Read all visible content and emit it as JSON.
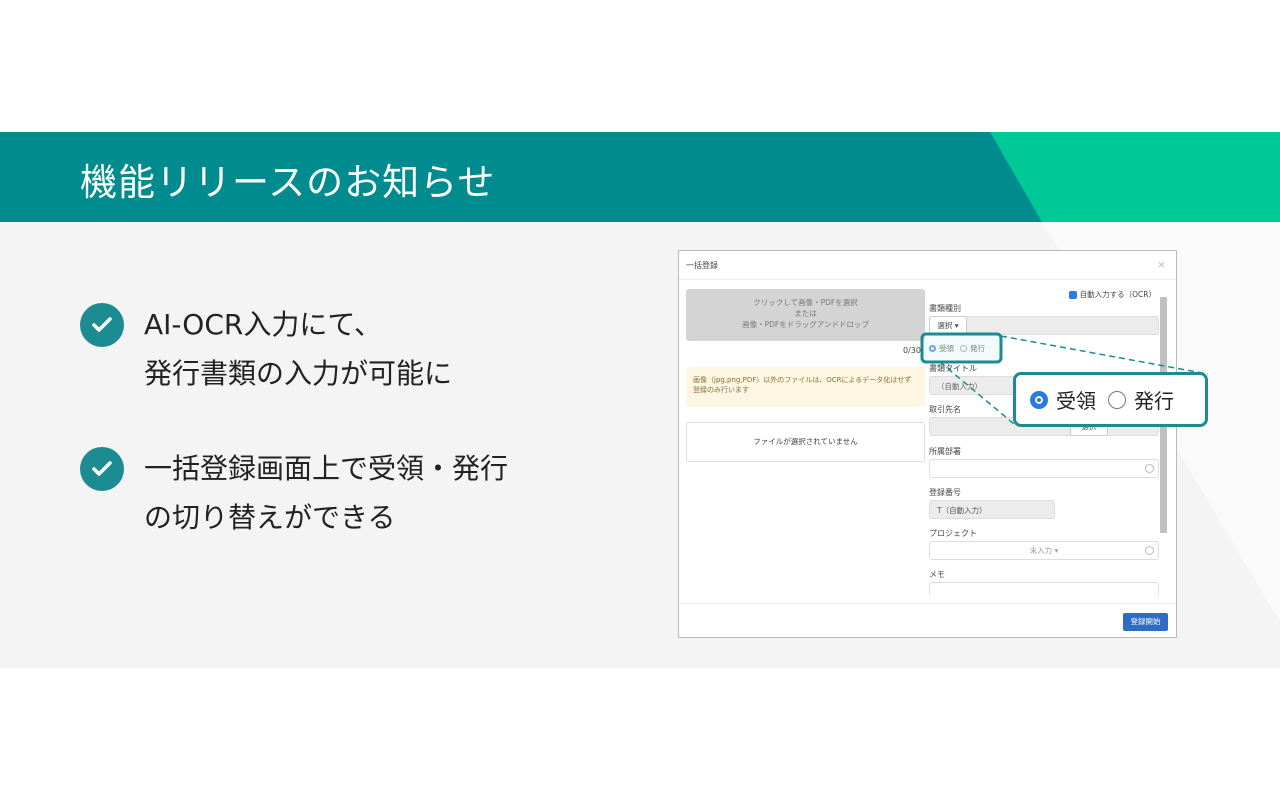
{
  "header": {
    "title": "機能リリースのお知らせ",
    "colors": {
      "band": "#008b8f",
      "accent": "#00c896"
    }
  },
  "features": [
    {
      "icon": "check-circle-icon",
      "lines": [
        "AI-OCR入力にて、",
        "発行書類の入力が可能に"
      ]
    },
    {
      "icon": "check-circle-icon",
      "lines": [
        "一括登録画面上で受領・発行",
        "の切り替えができる"
      ]
    }
  ],
  "dialog": {
    "title": "一括登録",
    "close": "×",
    "upload": {
      "line1": "クリックして画像・PDFを選択",
      "line2": "または",
      "line3": "画像・PDFをドラッグアンドドロップ"
    },
    "count": "0/30",
    "notice": "画像（jpg,png,PDF）以外のファイルは、OCRによるデータ化はせず登録のみ行います",
    "no_file": "ファイルが選択されていません",
    "auto_ocr": {
      "label": "自動入力する（OCR）",
      "checked": true
    },
    "doc_type": {
      "label": "書類種別",
      "select": "選択 ▾"
    },
    "direction": {
      "options": [
        "受領",
        "発行"
      ],
      "selected": "受領"
    },
    "doc_title": {
      "label": "書類タイトル",
      "value": "（自動入力）"
    },
    "partner": {
      "label": "取引先名",
      "button": "選択"
    },
    "department": {
      "label": "所属部署"
    },
    "reg_number": {
      "label": "登録番号",
      "value": "T（自動入力）"
    },
    "project": {
      "label": "プロジェクト",
      "value": "未入力 ▾"
    },
    "memo": {
      "label": "メモ"
    },
    "submit": "登録開始"
  }
}
